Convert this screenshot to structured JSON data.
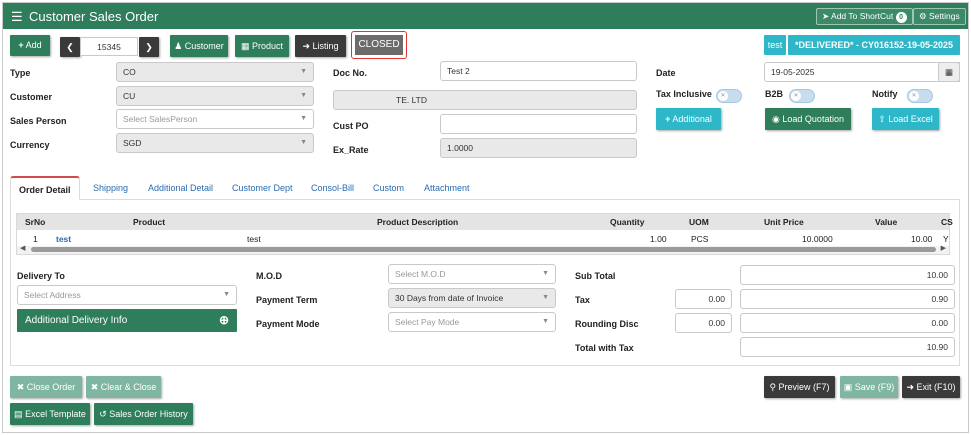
{
  "window": {
    "title": "Customer Sales Order"
  },
  "topbar": {
    "shortcut_label": "Add To ShortCut",
    "shortcut_badge": "0",
    "settings_label": "Settings"
  },
  "toolbar": {
    "add_label": "Add",
    "record_no": "15345",
    "customer_label": "Customer",
    "product_label": "Product",
    "listing_label": "Listing",
    "closed_label": "CLOSED",
    "test_badge": "test",
    "status_banner": "*DELIVERED* - CY016152-19-05-2025"
  },
  "form": {
    "type_label": "Type",
    "type_value": "CO",
    "customer_label": "Customer",
    "customer_value": "CU",
    "salesperson_label": "Sales Person",
    "salesperson_placeholder": "Select SalesPerson",
    "currency_label": "Currency",
    "currency_value": "SGD",
    "docno_label": "Doc No.",
    "docno_value": "Test 2",
    "customer_name_value": "TE. LTD",
    "custpo_label": "Cust PO",
    "custpo_value": "",
    "exrate_label": "Ex_Rate",
    "exrate_value": "1.0000",
    "date_label": "Date",
    "date_value": "19-05-2025",
    "tax_inclusive_label": "Tax Inclusive",
    "b2b_label": "B2B",
    "notify_label": "Notify",
    "additional_label": "Additional",
    "load_quotation_label": "Load Quotation",
    "load_excel_label": "Load Excel"
  },
  "tabs": [
    "Order Detail",
    "Shipping",
    "Additional Detail",
    "Customer Dept",
    "Consol-Bill",
    "Custom",
    "Attachment"
  ],
  "grid": {
    "headers": [
      "SrNo",
      "Product",
      "Product Description",
      "Quantity",
      "UOM",
      "Unit Price",
      "Value",
      "CS"
    ],
    "rows": [
      {
        "srno": "1",
        "product": "test",
        "description": "test",
        "quantity": "1.00",
        "uom": "PCS",
        "unit_price": "10.0000",
        "value": "10.00",
        "cs": "Y"
      }
    ]
  },
  "detail": {
    "delivery_to_label": "Delivery To",
    "address_placeholder": "Select Address",
    "additional_delivery_label": "Additional Delivery Info",
    "mod_label": "M.O.D",
    "mod_placeholder": "Select M.O.D",
    "payment_term_label": "Payment Term",
    "payment_term_value": "30 Days from date of Invoice",
    "payment_mode_label": "Payment Mode",
    "payment_mode_placeholder": "Select Pay Mode"
  },
  "totals": {
    "subtotal_label": "Sub Total",
    "subtotal_value": "10.00",
    "tax_label": "Tax",
    "tax_rate": "0.00",
    "tax_value": "0.90",
    "rounding_label": "Rounding Disc",
    "rounding_rate": "0.00",
    "rounding_value": "0.00",
    "total_label": "Total with Tax",
    "total_value": "10.90"
  },
  "footer": {
    "close_order": "Close Order",
    "clear_close": "Clear & Close",
    "excel_template": "Excel Template",
    "history": "Sales Order History",
    "preview": "Preview (F7)",
    "save": "Save (F9)",
    "exit": "Exit (F10)"
  },
  "colors": {
    "primary": "#2e7d5b",
    "accent": "#2db7c9",
    "closed_border": "#dd3333"
  }
}
